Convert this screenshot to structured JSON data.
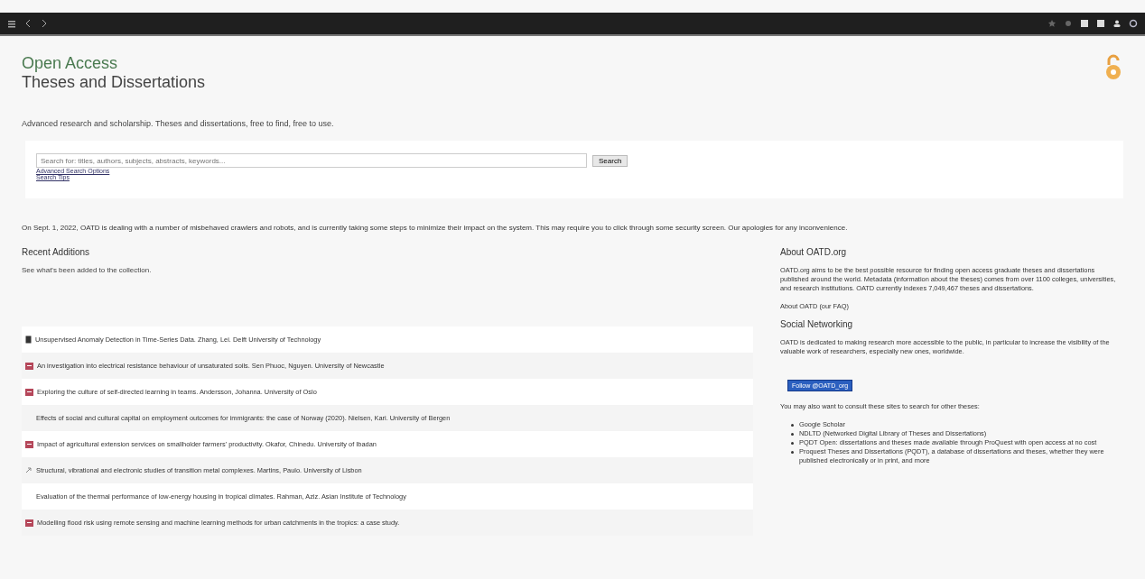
{
  "header": {
    "title_line_1": "Open Access",
    "title_line_2": "Theses and Dissertations"
  },
  "tagline": "Advanced research and scholarship. Theses and dissertations, free to find, free to use.",
  "search": {
    "placeholder": "Search for: titles, authors, subjects, abstracts, keywords...",
    "button": "Search",
    "links": [
      "Advanced Search Options",
      "Search Tips"
    ]
  },
  "notice": "On Sept. 1, 2022, OATD is dealing with a number of misbehaved crawlers and robots, and is currently taking some steps to minimize their impact on the system. This may require you to click through some security screen. Our apologies for any inconvenience.",
  "recent": {
    "title": "Recent Additions",
    "intro": "See what's been added to the collection.",
    "items": [
      {
        "kind": "doc",
        "text": "Unsupervised Anomaly Detection in Time-Series Data. Zhang, Lei. Delft University of Technology"
      },
      {
        "kind": "pdf",
        "text": "An investigation into electrical resistance behaviour of unsaturated soils. Sen Phuoc, Nguyen. University of Newcastle"
      },
      {
        "kind": "pdf",
        "text": "Exploring the culture of self-directed learning in teams. Andersson, Johanna. University of Oslo"
      },
      {
        "kind": "none",
        "text": "Effects of social and cultural capital on employment outcomes for immigrants: the case of Norway (2020). Nielsen, Kari. University of Bergen"
      },
      {
        "kind": "pdf",
        "text": "Impact of agricultural extension services on smallholder farmers' productivity. Okafor, Chinedu. University of Ibadan"
      },
      {
        "kind": "link",
        "text": "Structural, vibrational and electronic studies of transition metal complexes. Martins, Paulo. University of Lisbon"
      },
      {
        "kind": "none",
        "text": "Evaluation of the thermal performance of low-energy housing in tropical climates. Rahman, Aziz. Asian Institute of Technology"
      },
      {
        "kind": "pdf",
        "text": "Modelling flood risk using remote sensing and machine learning methods for urban catchments in the tropics: a case study."
      }
    ]
  },
  "about": {
    "title": "About OATD.org",
    "text": "OATD.org aims to be the best possible resource for finding open access graduate theses and dissertations published around the world. Metadata (information about the theses) comes from over 1100 colleges, universities, and research institutions. OATD currently indexes 7,049,467 theses and dissertations.",
    "link": "About OATD (our FAQ)"
  },
  "social": {
    "title": "Social Networking",
    "text": "OATD is dedicated to making research more accessible to the public, in particular to increase the visibility of the valuable work of researchers, especially new ones, worldwide.",
    "button": "Follow @OATD_org"
  },
  "other": {
    "intro": "You may also want to consult these sites to search for other theses:",
    "items": [
      "Google Scholar",
      "NDLTD (Networked Digital Library of Theses and Dissertations)",
      "PQDT Open: dissertations and theses made available through ProQuest with open access at no cost",
      "Proquest Theses and Dissertations (PQDT), a database of dissertations and theses, whether they were published electronically or in print, and more"
    ]
  }
}
